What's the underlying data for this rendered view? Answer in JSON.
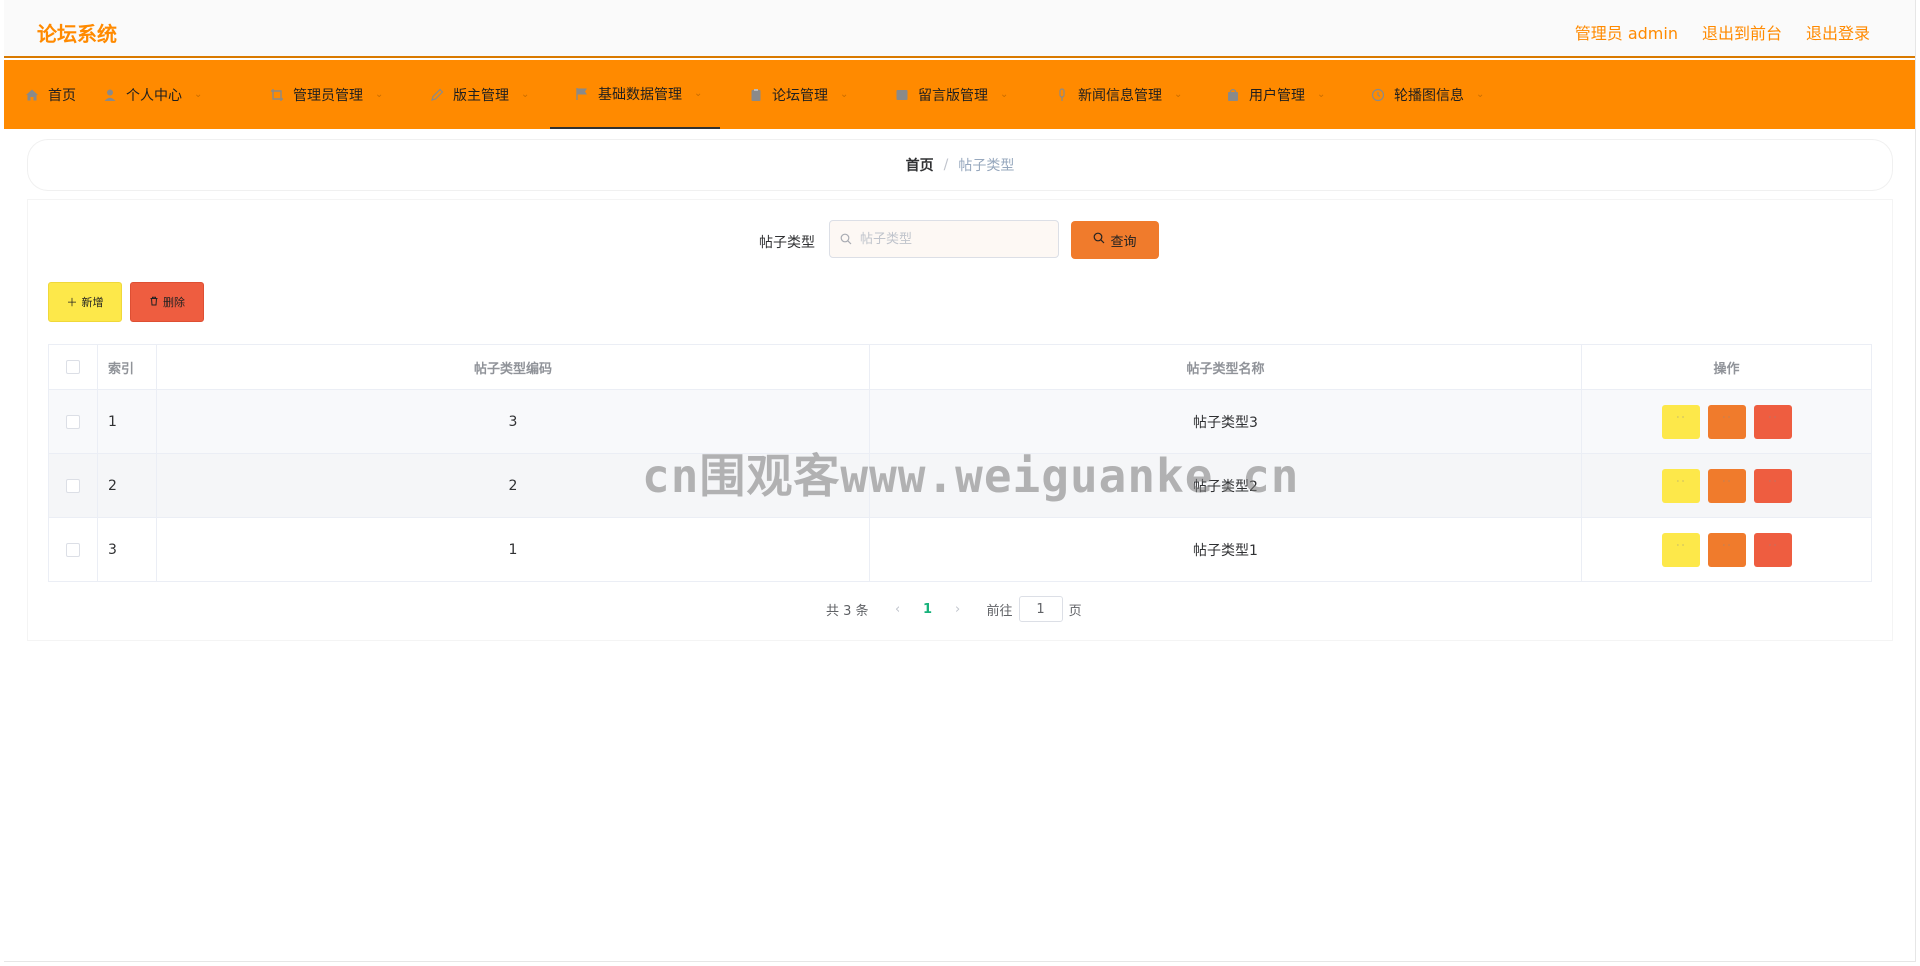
{
  "header": {
    "brand": "论坛系统",
    "links": [
      "管理员 admin",
      "退出到前台",
      "退出登录"
    ]
  },
  "nav": {
    "items": [
      {
        "label": "首页",
        "icon": "home-icon",
        "dropdown": false
      },
      {
        "label": "个人中心",
        "icon": "user-icon",
        "dropdown": true
      },
      {
        "label": "管理员管理",
        "icon": "crop-icon",
        "dropdown": true
      },
      {
        "label": "版主管理",
        "icon": "edit-pen-icon",
        "dropdown": true
      },
      {
        "label": "基础数据管理",
        "icon": "flag-icon",
        "dropdown": true,
        "active": true
      },
      {
        "label": "论坛管理",
        "icon": "clipboard-icon",
        "dropdown": true
      },
      {
        "label": "留言版管理",
        "icon": "message-box-icon",
        "dropdown": true
      },
      {
        "label": "新闻信息管理",
        "icon": "microphone-icon",
        "dropdown": true
      },
      {
        "label": "用户管理",
        "icon": "shopping-bag-icon",
        "dropdown": true
      },
      {
        "label": "轮播图信息",
        "icon": "clock-icon",
        "dropdown": true
      }
    ]
  },
  "breadcrumb": {
    "home": "首页",
    "separator": "/",
    "current": "帖子类型"
  },
  "search": {
    "label": "帖子类型",
    "placeholder": "帖子类型",
    "button": "查询"
  },
  "actions": {
    "add": "新增",
    "delete": "删除"
  },
  "table": {
    "columns": [
      "索引",
      "帖子类型编码",
      "帖子类型名称",
      "操作"
    ],
    "rows": [
      {
        "index": "1",
        "code": "3",
        "name": "帖子类型3"
      },
      {
        "index": "2",
        "code": "2",
        "name": "帖子类型2"
      },
      {
        "index": "3",
        "code": "1",
        "name": "帖子类型1"
      }
    ]
  },
  "pagination": {
    "total": "共 3 条",
    "current": "1",
    "goto": "前往",
    "jump_value": "1",
    "page_suffix": "页"
  },
  "watermark": "cn围观客www.weiguanke.cn",
  "colors": {
    "brand": "#ff8a00",
    "nav_bg": "#ff8a00",
    "btn_yellow": "#fde84a",
    "btn_orange": "#f07b2c",
    "btn_red": "#ee5d40",
    "page_active": "#18b27b"
  }
}
